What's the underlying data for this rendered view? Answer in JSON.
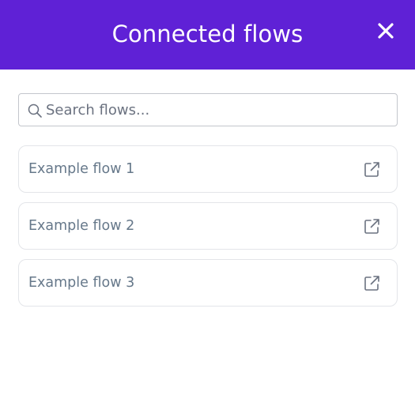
{
  "header": {
    "title": "Connected flows",
    "close_icon": "close-icon",
    "bg_color": "#5f21d6"
  },
  "search": {
    "value": "",
    "placeholder": "Search flows...",
    "icon": "search-icon"
  },
  "flows": [
    {
      "label": "Example flow 1",
      "icon": "external-link-icon"
    },
    {
      "label": "Example flow 2",
      "icon": "external-link-icon"
    },
    {
      "label": "Example flow 3",
      "icon": "external-link-icon"
    }
  ]
}
